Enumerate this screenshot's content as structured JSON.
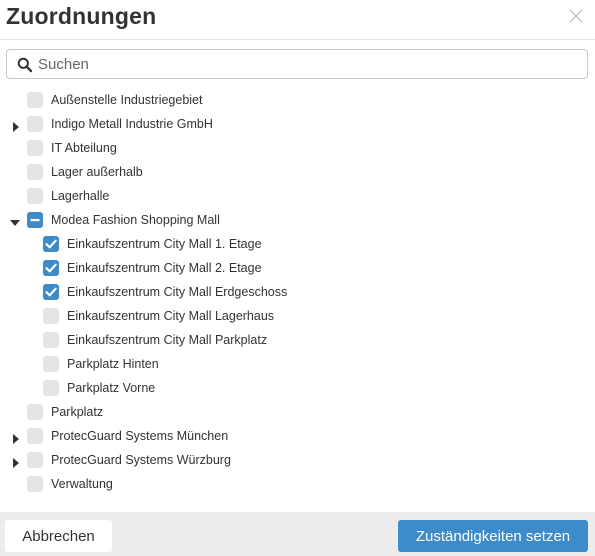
{
  "dialog": {
    "title": "Zuordnungen",
    "close_icon": "close-icon"
  },
  "search": {
    "placeholder": "Suchen",
    "value": "",
    "icon": "search-icon"
  },
  "tree": [
    {
      "label": "Außenstelle Industriegebiet",
      "level": 0,
      "expander": "none",
      "state": "unchecked"
    },
    {
      "label": "Indigo Metall Industrie GmbH",
      "level": 0,
      "expander": "collapsed",
      "state": "unchecked"
    },
    {
      "label": "IT Abteilung",
      "level": 0,
      "expander": "none",
      "state": "unchecked"
    },
    {
      "label": "Lager außerhalb",
      "level": 0,
      "expander": "none",
      "state": "unchecked"
    },
    {
      "label": "Lagerhalle",
      "level": 0,
      "expander": "none",
      "state": "unchecked"
    },
    {
      "label": "Modea Fashion Shopping Mall",
      "level": 0,
      "expander": "expanded",
      "state": "partial"
    },
    {
      "label": "Einkaufszentrum City Mall 1. Etage",
      "level": 1,
      "expander": "none",
      "state": "checked"
    },
    {
      "label": "Einkaufszentrum City Mall 2. Etage",
      "level": 1,
      "expander": "none",
      "state": "checked"
    },
    {
      "label": "Einkaufszentrum City Mall Erdgeschoss",
      "level": 1,
      "expander": "none",
      "state": "checked"
    },
    {
      "label": "Einkaufszentrum City Mall Lagerhaus",
      "level": 1,
      "expander": "none",
      "state": "unchecked"
    },
    {
      "label": "Einkaufszentrum City Mall Parkplatz",
      "level": 1,
      "expander": "none",
      "state": "unchecked"
    },
    {
      "label": "Parkplatz Hinten",
      "level": 1,
      "expander": "none",
      "state": "unchecked"
    },
    {
      "label": "Parkplatz Vorne",
      "level": 1,
      "expander": "none",
      "state": "unchecked"
    },
    {
      "label": "Parkplatz",
      "level": 0,
      "expander": "none",
      "state": "unchecked"
    },
    {
      "label": "ProtecGuard Systems München",
      "level": 0,
      "expander": "collapsed",
      "state": "unchecked"
    },
    {
      "label": "ProtecGuard Systems Würzburg",
      "level": 0,
      "expander": "collapsed",
      "state": "unchecked"
    },
    {
      "label": "Verwaltung",
      "level": 0,
      "expander": "none",
      "state": "unchecked"
    }
  ],
  "footer": {
    "cancel_label": "Abbrechen",
    "submit_label": "Zuständigkeiten setzen"
  },
  "colors": {
    "accent": "#3d8bc9",
    "checkbox_unchecked": "#e4e4e4",
    "footer_background": "#ececec",
    "text": "#333333"
  }
}
